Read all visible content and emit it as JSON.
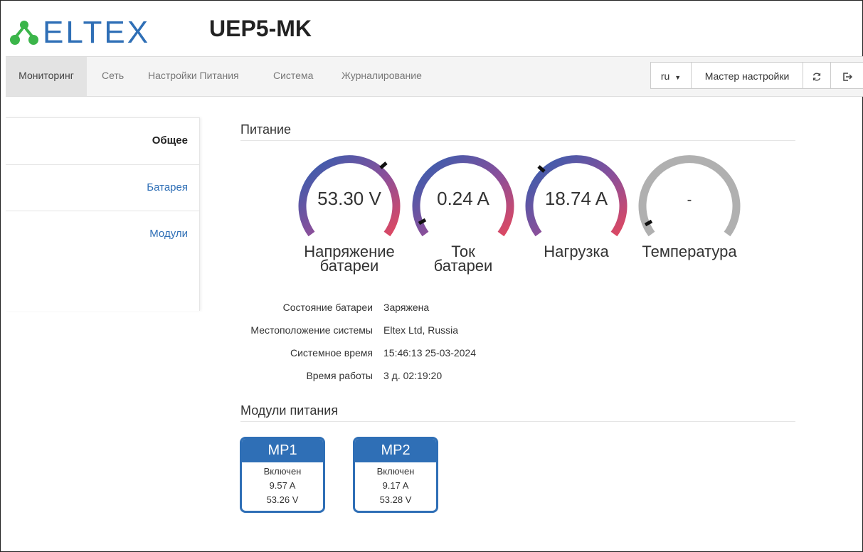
{
  "header": {
    "logo": "ELTEX",
    "device": "UEP5-MK"
  },
  "nav": {
    "tabs": [
      "Мониторинг",
      "Сеть",
      "Настройки Питания",
      "Система",
      "Журналирование"
    ],
    "lang": "ru",
    "wizard": "Мастер настройки"
  },
  "sidebar": {
    "items": [
      "Общее",
      "Батарея",
      "Модули"
    ]
  },
  "power": {
    "title": "Питание",
    "gauges": [
      {
        "value": "53.30 V",
        "label1": "Напряжение",
        "label2": "батареи"
      },
      {
        "value": "0.24 A",
        "label1": "Ток",
        "label2": "батареи"
      },
      {
        "value": "18.74 A",
        "label1": "Нагрузка",
        "label2": ""
      },
      {
        "value": "-",
        "label1": "Температура",
        "label2": ""
      }
    ]
  },
  "info": [
    {
      "label": "Состояние батареи",
      "value": "Заряжена"
    },
    {
      "label": "Местоположение системы",
      "value": "Eltex Ltd, Russia"
    },
    {
      "label": "Системное время",
      "value": "15:46:13 25-03-2024"
    },
    {
      "label": "Время работы",
      "value": "3 д. 02:19:20"
    }
  ],
  "modules": {
    "title": "Модули питания",
    "items": [
      {
        "name": "MP1",
        "state": "Включен",
        "current": "9.57 A",
        "voltage": "53.26 V"
      },
      {
        "name": "MP2",
        "state": "Включен",
        "current": "9.17 A",
        "voltage": "53.28 V"
      }
    ]
  },
  "colors": {
    "brand": "#2f6fb6",
    "gauge_start": "#2f5fb0",
    "gauge_end": "#e04860",
    "gauge_empty": "#b0b0b0"
  }
}
